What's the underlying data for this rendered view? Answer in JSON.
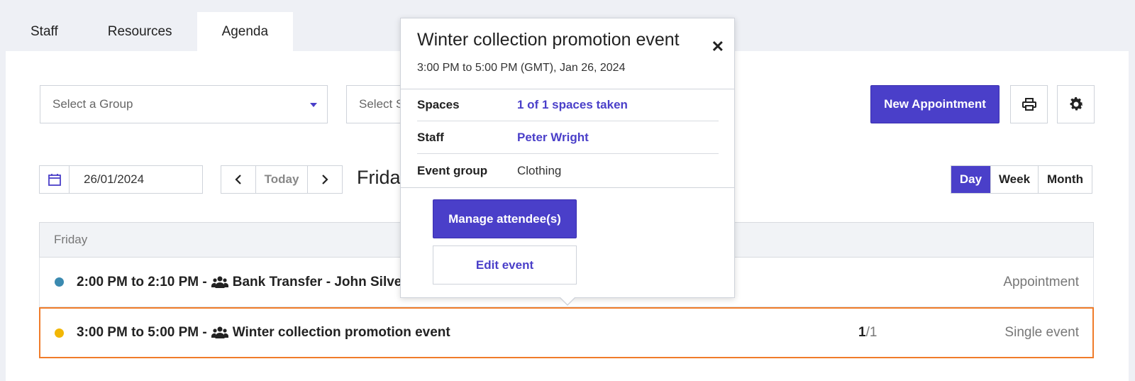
{
  "tabs": [
    {
      "label": "Staff"
    },
    {
      "label": "Resources"
    },
    {
      "label": "Agenda",
      "active": true
    }
  ],
  "toolbar": {
    "group_select": "Select a Group",
    "staff_select": "Select S",
    "new_appointment_label": "New Appointment"
  },
  "datebar": {
    "date_value": "26/01/2024",
    "today_label": "Today",
    "day_title": "Friday"
  },
  "view_toggle": {
    "day": "Day",
    "week": "Week",
    "month": "Month",
    "active": "Day"
  },
  "agenda": {
    "header": "Friday",
    "rows": [
      {
        "time": "2:00 PM to 2:10 PM -",
        "title": "Bank Transfer - John Silver",
        "type": "Appointment",
        "dot_color": "#3b8ab0"
      },
      {
        "time": "3:00 PM to 5:00 PM -",
        "title": "Winter collection promotion event",
        "type": "Single event",
        "dot_color": "#f2b705",
        "count_taken": "1",
        "count_total": "/1"
      }
    ]
  },
  "popover": {
    "title": "Winter collection promotion event",
    "when": "3:00 PM to 5:00 PM (GMT), Jan 26, 2024",
    "spaces_label": "Spaces",
    "spaces_value": "1 of 1 spaces taken",
    "staff_label": "Staff",
    "staff_value": "Peter Wright",
    "group_label": "Event group",
    "group_value": "Clothing",
    "manage_label": "Manage attendee(s)",
    "edit_label": "Edit event"
  },
  "colors": {
    "accent": "#4a3fc9",
    "selected_border": "#f07c2a"
  }
}
